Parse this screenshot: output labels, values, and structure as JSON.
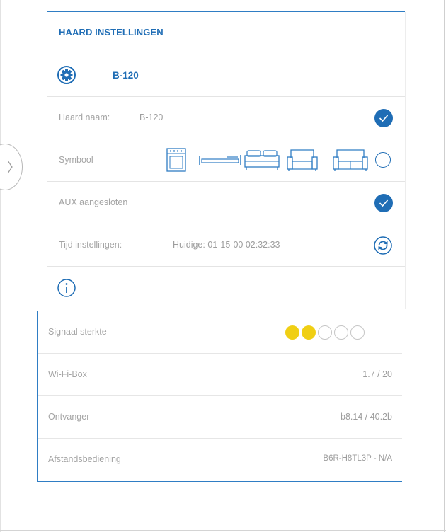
{
  "panel": {
    "title": "HAARD INSTELLINGEN",
    "device_name": "B-120"
  },
  "settings": {
    "name_label": "Haard naam:",
    "name_value": "B-120",
    "symbol_label": "Symbool",
    "symbol_icons": [
      "oven-icon",
      "bench-icon",
      "bed-icon",
      "armchair-icon",
      "sofa-icon"
    ],
    "aux_label": "AUX aangesloten",
    "time_label": "Tijd instellingen:",
    "time_value": "Huidige: 01-15-00 02:32:33"
  },
  "info": {
    "signal_label": "Signaal sterkte",
    "signal_level": 2,
    "signal_max": 5,
    "wifi_label": "Wi-Fi-Box",
    "wifi_value": "1.7 / 20",
    "receiver_label": "Ontvanger",
    "receiver_value": "b8.14 / 40.2b",
    "remote_label": "Afstandsbediening",
    "remote_value": "B6R-H8TL3P - N/A"
  },
  "colors": {
    "accent": "#1f6db5",
    "signal_on": "#f0cf14",
    "signal_off": "#ffffff"
  }
}
